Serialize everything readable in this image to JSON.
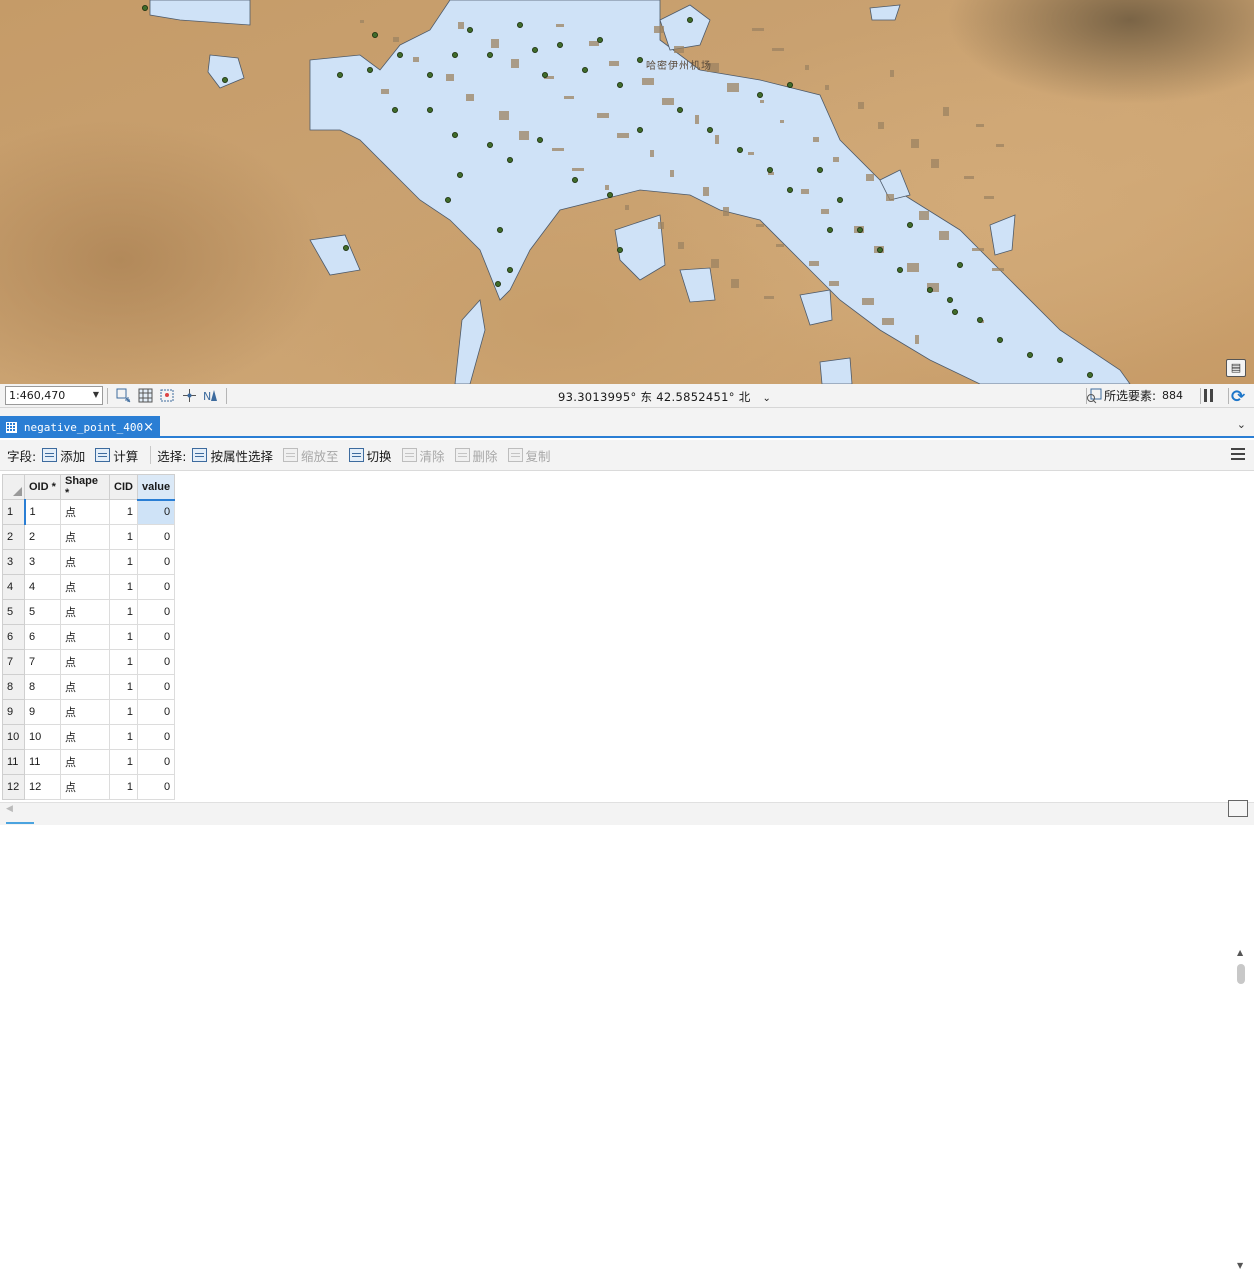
{
  "map": {
    "place_label": "哈密伊州机场",
    "colors": {
      "desert": "#c9a170",
      "urban_fill": "#cfe2f7",
      "urban_stroke": "#4d5a6a",
      "point_fill": "#3f6b2a"
    }
  },
  "status_bar": {
    "scale": "1:460,470",
    "coordinates": "93.3013995° 东 42.5852451° 北",
    "selected_label": "所选要素:",
    "selected_count": "884"
  },
  "tab": {
    "title": "negative_point_400",
    "close_icon": "×"
  },
  "toolbar": {
    "field_label": "字段:",
    "add_label": "添加",
    "calculate_label": "计算",
    "select_label": "选择:",
    "select_by_attr_label": "按属性选择",
    "zoom_to_label": "缩放至",
    "switch_label": "切换",
    "clear_label": "清除",
    "delete_label": "删除",
    "copy_label": "复制"
  },
  "table": {
    "columns": [
      "OID *",
      "Shape *",
      "CID",
      "value"
    ],
    "rows": [
      {
        "row": "1",
        "oid": "1",
        "shape": "点",
        "cid": "1",
        "value": "0"
      },
      {
        "row": "2",
        "oid": "2",
        "shape": "点",
        "cid": "1",
        "value": "0"
      },
      {
        "row": "3",
        "oid": "3",
        "shape": "点",
        "cid": "1",
        "value": "0"
      },
      {
        "row": "4",
        "oid": "4",
        "shape": "点",
        "cid": "1",
        "value": "0"
      },
      {
        "row": "5",
        "oid": "5",
        "shape": "点",
        "cid": "1",
        "value": "0"
      },
      {
        "row": "6",
        "oid": "6",
        "shape": "点",
        "cid": "1",
        "value": "0"
      },
      {
        "row": "7",
        "oid": "7",
        "shape": "点",
        "cid": "1",
        "value": "0"
      },
      {
        "row": "8",
        "oid": "8",
        "shape": "点",
        "cid": "1",
        "value": "0"
      },
      {
        "row": "9",
        "oid": "9",
        "shape": "点",
        "cid": "1",
        "value": "0"
      },
      {
        "row": "10",
        "oid": "10",
        "shape": "点",
        "cid": "1",
        "value": "0"
      },
      {
        "row": "11",
        "oid": "11",
        "shape": "点",
        "cid": "1",
        "value": "0"
      },
      {
        "row": "12",
        "oid": "12",
        "shape": "点",
        "cid": "1",
        "value": "0"
      }
    ]
  }
}
